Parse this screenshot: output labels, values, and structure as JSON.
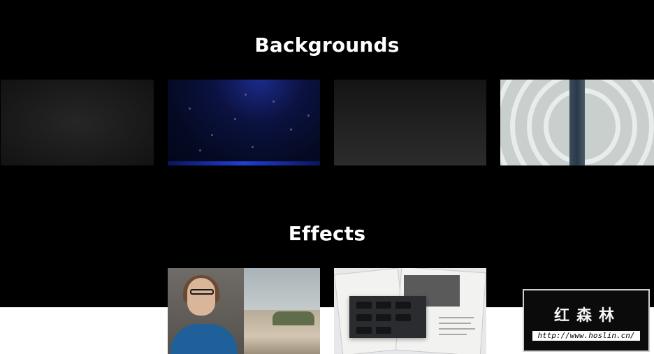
{
  "sections": {
    "backgrounds": {
      "title": "Backgrounds",
      "items": [
        {
          "name": "dark-grain-background"
        },
        {
          "name": "blue-particles-background"
        },
        {
          "name": "dark-gradient-background"
        },
        {
          "name": "spiral-staircase-background"
        }
      ]
    },
    "effects": {
      "title": "Effects",
      "items": [
        {
          "name": "woman-city-split-effect"
        },
        {
          "name": "keyboard-newspaper-effect"
        }
      ]
    }
  },
  "watermark": {
    "brand": "红森林",
    "url": "http://www.hoslin.cn/"
  },
  "colors": {
    "page_background": "#000000",
    "lower_band": "#ffffff",
    "title_text": "#ffffff"
  }
}
